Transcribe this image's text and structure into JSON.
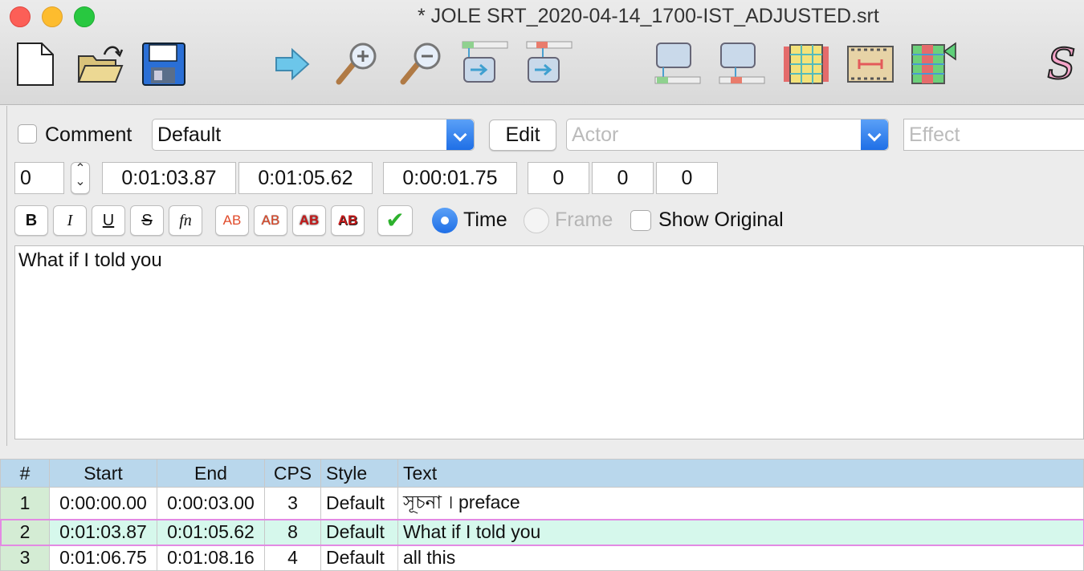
{
  "window": {
    "title": "* JOLE SRT_2020-04-14_1700-IST_ADJUSTED.srt"
  },
  "toolbar": {
    "icons": [
      "new-file-icon",
      "open-folder-icon",
      "save-icon",
      "jump-arrow-icon",
      "zoom-in-icon",
      "zoom-out-icon",
      "jump-to-start-icon",
      "jump-to-end-icon",
      "snap-start-icon",
      "snap-end-icon",
      "styles-manager-icon",
      "video-timing-icon",
      "shift-times-icon",
      "subtitle-s-icon"
    ]
  },
  "edit": {
    "comment_label": "Comment",
    "style_value": "Default",
    "edit_button": "Edit",
    "actor_placeholder": "Actor",
    "effect_placeholder": "Effect",
    "layer": "0",
    "start_time": "0:01:03.87",
    "end_time": "0:01:05.62",
    "duration": "0:00:01.75",
    "margin_left": "0",
    "margin_right": "0",
    "margin_vert": "0",
    "format_buttons": [
      "B",
      "I",
      "U",
      "S",
      "fn"
    ],
    "color_buttons": [
      "AB",
      "AB",
      "AB",
      "AB"
    ],
    "time_label": "Time",
    "frame_label": "Frame",
    "show_original_label": "Show Original",
    "text": "What if I told you"
  },
  "grid": {
    "headers": [
      "#",
      "Start",
      "End",
      "CPS",
      "Style",
      "Text"
    ],
    "rows": [
      {
        "num": "1",
        "start": "0:00:00.00",
        "end": "0:00:03.00",
        "cps": "3",
        "style": "Default",
        "text": "সূচনা । preface"
      },
      {
        "num": "2",
        "start": "0:01:03.87",
        "end": "0:01:05.62",
        "cps": "8",
        "style": "Default",
        "text": "What if I told you"
      },
      {
        "num": "3",
        "start": "0:01:06.75",
        "end": "0:01:08.16",
        "cps": "4",
        "style": "Default",
        "text": "all this"
      }
    ],
    "selected_row": 2
  },
  "colors": {
    "header_bg": "#b9d7ec",
    "number_col_bg": "#d4ecd4",
    "selected_row_bg": "#d6f8ec",
    "selected_row_border": "#e38ae3",
    "accent_blue": "#1f6fe6"
  }
}
